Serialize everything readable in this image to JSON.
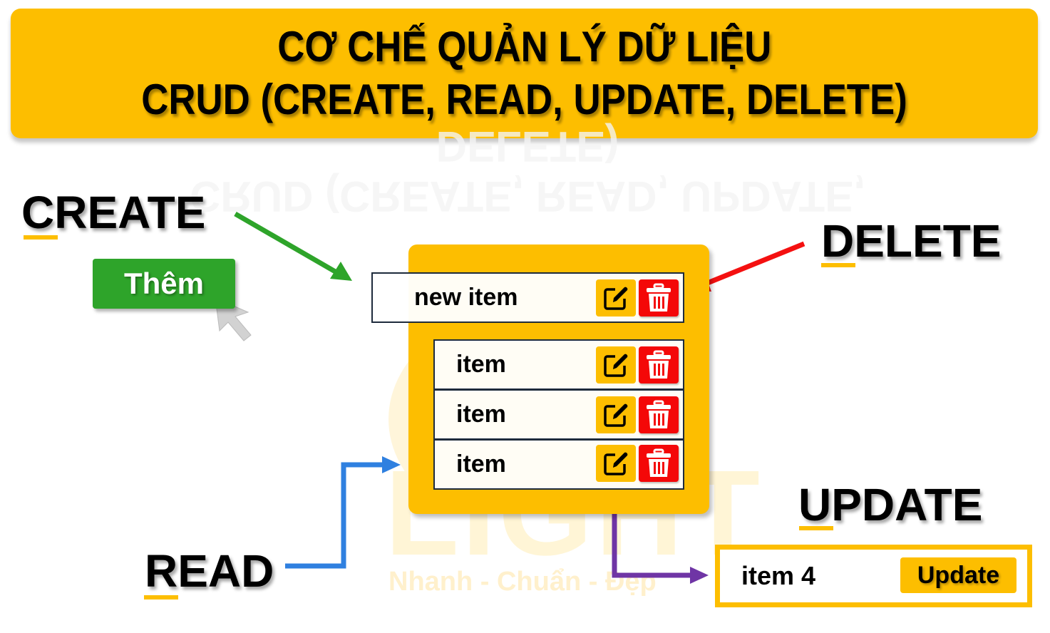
{
  "title": {
    "line1": "CƠ CHẾ QUẢN LÝ DỮ LIỆU",
    "line2": "CRUD (CREATE, READ, UPDATE, DELETE)"
  },
  "labels": {
    "create": "CREATE",
    "read": "READ",
    "update": "UPDATE",
    "delete": "DELETE"
  },
  "create_button": {
    "label": "Thêm"
  },
  "list": {
    "new_item": "new item",
    "items": [
      "item",
      "item",
      "item"
    ]
  },
  "update_form": {
    "value": "item 4",
    "button_label": "Update"
  },
  "watermark": {
    "logo": "LIGHT",
    "slogan": "Nhanh - Chuẩn - Đẹp"
  },
  "icons": {
    "edit": "edit-icon",
    "delete": "trash-icon",
    "cursor": "mouse-pointer-icon"
  },
  "colors": {
    "accent_yellow": "#fdbe00",
    "create_green": "#2ea42a",
    "delete_red": "#f40808",
    "read_blue": "#2f80e0",
    "update_purple": "#6f35a5",
    "row_border": "#1e2b3c"
  }
}
